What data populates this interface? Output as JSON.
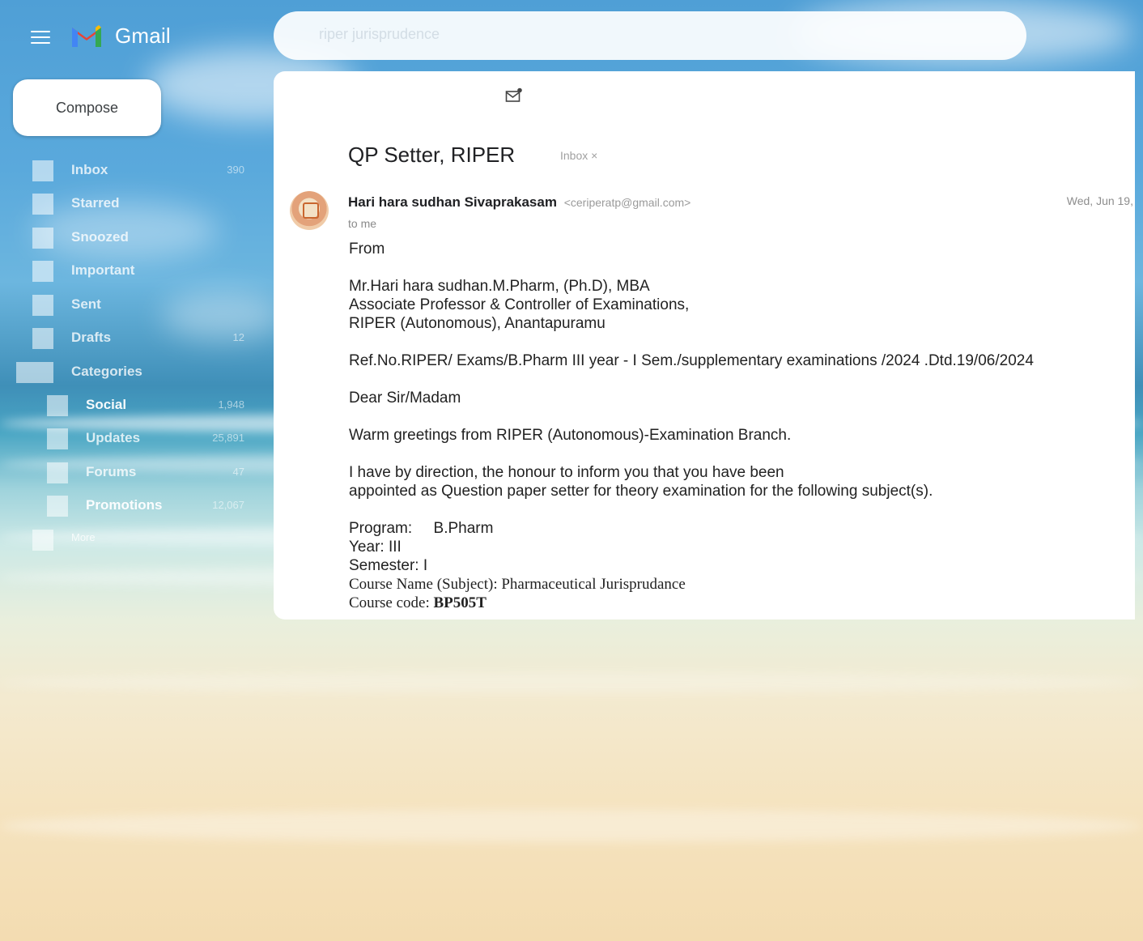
{
  "app": {
    "name": "Gmail"
  },
  "search": {
    "placeholder": "riper jurisprudence"
  },
  "compose": {
    "label": "Compose"
  },
  "nav": {
    "items": [
      {
        "label": "Inbox",
        "count": "390"
      },
      {
        "label": "Starred",
        "count": ""
      },
      {
        "label": "Snoozed",
        "count": ""
      },
      {
        "label": "Important",
        "count": ""
      },
      {
        "label": "Sent",
        "count": ""
      },
      {
        "label": "Drafts",
        "count": "12"
      },
      {
        "label": "Categories",
        "count": ""
      },
      {
        "label": "Social",
        "count": "1,948"
      },
      {
        "label": "Updates",
        "count": "25,891"
      },
      {
        "label": "Forums",
        "count": "47"
      },
      {
        "label": "Promotions",
        "count": "12,067"
      },
      {
        "label": "More",
        "count": ""
      }
    ]
  },
  "email": {
    "subject": "QP Setter, RIPER",
    "label_chip": "Inbox ×",
    "sender_name": "Hari hara sudhan Sivaprakasam",
    "sender_email": "<ceriperatp@gmail.com>",
    "date": "Wed, Jun 19,",
    "to": "to me",
    "body": {
      "from": "From",
      "signature": "Mr.Hari hara sudhan.M.Pharm, (Ph.D), MBA\nAssociate Professor  & Controller of Examinations,\nRIPER (Autonomous), Anantapuramu",
      "ref": "Ref.No.RIPER/ Exams/B.Pharm III year - I Sem./supplementary examinations /2024 .Dtd.19/06/2024",
      "greeting": "Dear Sir/Madam",
      "warm": "Warm greetings from RIPER (Autonomous)-Examination Branch.",
      "inform": "I have by direction, the honour to inform you that you have been\nappointed as Question paper setter for theory examination for the following subject(s).",
      "program": "Program:     B.Pharm",
      "year": "Year: III",
      "semester": "Semester: I",
      "course_name": "Course Name (Subject): Pharmaceutical Jurisprudance",
      "course_code_label": "Course code:",
      "course_code": "BP505T"
    }
  },
  "colors": {
    "sky": "#4f9fd6",
    "sea": "#3f8fb8",
    "sand": "#f3dcb1",
    "panel": "#ffffff"
  }
}
